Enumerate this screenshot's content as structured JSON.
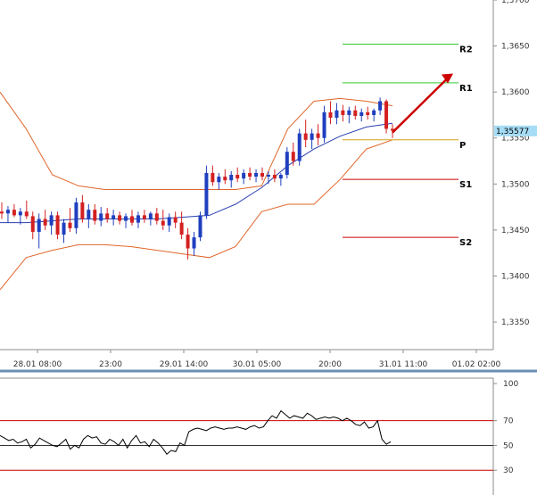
{
  "chart_data": [
    {
      "type": "candlestick",
      "x": [
        "28.01 08:00",
        "23:00",
        "29.01 14:00",
        "30.01 05:00",
        "20:00",
        "31.01 11:00",
        "01.02 02:00"
      ],
      "ytick_labels": [
        "1,3700",
        "1,3650",
        "1,3600",
        "1,3550",
        "1,3500",
        "1,3450",
        "1,3400",
        "1,3350"
      ],
      "yticks": [
        1.37,
        1.365,
        1.36,
        1.355,
        1.35,
        1.345,
        1.34,
        1.335
      ],
      "ylim": [
        1.332,
        1.37
      ],
      "current_price": 1.35577,
      "current_price_label": "1,35577",
      "grid": false,
      "levels": [
        {
          "name": "R2",
          "value": 1.3652,
          "color": "#33cc33"
        },
        {
          "name": "R1",
          "value": 1.361,
          "color": "#33cc33"
        },
        {
          "name": "P",
          "value": 1.3548,
          "color": "#d4a017"
        },
        {
          "name": "S1",
          "value": 1.3505,
          "color": "#cc0000"
        },
        {
          "name": "S2",
          "value": 1.3442,
          "color": "#cc0000"
        }
      ],
      "candles": [
        [
          1.347,
          1.348,
          1.3462,
          1.3468
        ],
        [
          1.3468,
          1.3476,
          1.3458,
          1.3472
        ],
        [
          1.3472,
          1.3478,
          1.3464,
          1.3466
        ],
        [
          1.3466,
          1.3474,
          1.3456,
          1.347
        ],
        [
          1.347,
          1.3482,
          1.3462,
          1.3465
        ],
        [
          1.3465,
          1.347,
          1.344,
          1.3448
        ],
        [
          1.3448,
          1.3468,
          1.343,
          1.3462
        ],
        [
          1.3462,
          1.3472,
          1.345,
          1.3455
        ],
        [
          1.3455,
          1.347,
          1.3445,
          1.3466
        ],
        [
          1.3466,
          1.347,
          1.344,
          1.3445
        ],
        [
          1.3445,
          1.3462,
          1.3436,
          1.3458
        ],
        [
          1.3458,
          1.3474,
          1.3448,
          1.3452
        ],
        [
          1.3452,
          1.3485,
          1.3446,
          1.348
        ],
        [
          1.348,
          1.3488,
          1.3458,
          1.3462
        ],
        [
          1.3462,
          1.3478,
          1.3452,
          1.3472
        ],
        [
          1.3472,
          1.3478,
          1.3456,
          1.346
        ],
        [
          1.346,
          1.3475,
          1.3454,
          1.3468
        ],
        [
          1.3468,
          1.3474,
          1.3458,
          1.3462
        ],
        [
          1.3462,
          1.3472,
          1.3455,
          1.3466
        ],
        [
          1.3466,
          1.347,
          1.3456,
          1.346
        ],
        [
          1.346,
          1.3468,
          1.3452,
          1.3465
        ],
        [
          1.3465,
          1.3472,
          1.3455,
          1.3458
        ],
        [
          1.3458,
          1.347,
          1.3452,
          1.3466
        ],
        [
          1.3466,
          1.3472,
          1.3458,
          1.3462
        ],
        [
          1.3462,
          1.347,
          1.3455,
          1.3468
        ],
        [
          1.3468,
          1.3474,
          1.3456,
          1.346
        ],
        [
          1.346,
          1.3472,
          1.345,
          1.3455
        ],
        [
          1.3455,
          1.3468,
          1.3448,
          1.3464
        ],
        [
          1.3464,
          1.347,
          1.3452,
          1.3458
        ],
        [
          1.3458,
          1.347,
          1.344,
          1.3445
        ],
        [
          1.3445,
          1.3452,
          1.3418,
          1.343
        ],
        [
          1.343,
          1.3448,
          1.3422,
          1.3442
        ],
        [
          1.3442,
          1.347,
          1.3438,
          1.3466
        ],
        [
          1.3466,
          1.352,
          1.3462,
          1.3512
        ],
        [
          1.3512,
          1.352,
          1.3498,
          1.3502
        ],
        [
          1.3502,
          1.3512,
          1.3494,
          1.3508
        ],
        [
          1.3508,
          1.3516,
          1.35,
          1.3504
        ],
        [
          1.3504,
          1.3514,
          1.3496,
          1.351
        ],
        [
          1.351,
          1.3518,
          1.3502,
          1.3506
        ],
        [
          1.3506,
          1.3516,
          1.35,
          1.3512
        ],
        [
          1.3512,
          1.3518,
          1.3504,
          1.3508
        ],
        [
          1.3508,
          1.3516,
          1.3502,
          1.3512
        ],
        [
          1.3512,
          1.3518,
          1.3504,
          1.3508
        ],
        [
          1.3508,
          1.3514,
          1.35,
          1.351
        ],
        [
          1.351,
          1.3516,
          1.3502,
          1.3506
        ],
        [
          1.3506,
          1.3512,
          1.3498,
          1.351
        ],
        [
          1.351,
          1.354,
          1.3506,
          1.3535
        ],
        [
          1.3535,
          1.3545,
          1.352,
          1.3525
        ],
        [
          1.3525,
          1.356,
          1.352,
          1.3555
        ],
        [
          1.3555,
          1.357,
          1.354,
          1.3548
        ],
        [
          1.3548,
          1.356,
          1.3538,
          1.3555
        ],
        [
          1.3555,
          1.3565,
          1.3542,
          1.355
        ],
        [
          1.355,
          1.3585,
          1.3545,
          1.3578
        ],
        [
          1.3578,
          1.359,
          1.3565,
          1.3572
        ],
        [
          1.3572,
          1.3588,
          1.3565,
          1.358
        ],
        [
          1.358,
          1.3586,
          1.3568,
          1.3575
        ],
        [
          1.3575,
          1.3584,
          1.3566,
          1.358
        ],
        [
          1.358,
          1.3585,
          1.357,
          1.3574
        ],
        [
          1.3574,
          1.3582,
          1.3568,
          1.3578
        ],
        [
          1.3578,
          1.3584,
          1.357,
          1.3575
        ],
        [
          1.3575,
          1.3582,
          1.3568,
          1.358
        ],
        [
          1.358,
          1.3594,
          1.3575,
          1.359
        ],
        [
          1.359,
          1.3592,
          1.3555,
          1.356
        ],
        [
          1.356,
          1.3565,
          1.355,
          1.3558
        ]
      ],
      "bollinger_upper": [
        1.36,
        1.356,
        1.351,
        1.3498,
        1.3494,
        1.3494,
        1.3494,
        1.3494,
        1.3494,
        1.3494,
        1.3498,
        1.356,
        1.359,
        1.3593,
        1.359,
        1.3585
      ],
      "bollinger_middle": [
        1.3458,
        1.3458,
        1.346,
        1.3462,
        1.3462,
        1.3462,
        1.3462,
        1.3464,
        1.3466,
        1.3478,
        1.3496,
        1.352,
        1.3538,
        1.3552,
        1.3562,
        1.3566
      ],
      "bollinger_lower": [
        1.3385,
        1.342,
        1.3428,
        1.3434,
        1.3434,
        1.3432,
        1.3428,
        1.3424,
        1.342,
        1.3432,
        1.347,
        1.3478,
        1.3478,
        1.3505,
        1.3538,
        1.3548
      ],
      "signal": {
        "from": 1.3556,
        "to": 1.362,
        "color": "#cc0000"
      }
    },
    {
      "type": "line",
      "x": [
        "28.01 08:00",
        "23:00",
        "29.01 14:00",
        "30.01 05:00",
        "20:00",
        "31.01 11:00",
        "01.02 02:00"
      ],
      "ytick_labels": [
        "100",
        "70",
        "50",
        "30"
      ],
      "yticks": [
        100,
        70,
        50,
        30
      ],
      "ylim": [
        10,
        100
      ],
      "levels": [
        {
          "value": 70,
          "color": "#cc0000"
        },
        {
          "value": 50,
          "color": "#333333"
        },
        {
          "value": 30,
          "color": "#cc0000"
        }
      ],
      "values": [
        58,
        56,
        54,
        55,
        52,
        53,
        55,
        48,
        51,
        56,
        54,
        52,
        50,
        49,
        52,
        55,
        47,
        50,
        48,
        55,
        58,
        56,
        57,
        52,
        51,
        55,
        53,
        50,
        55,
        48,
        54,
        58,
        52,
        53,
        49,
        55,
        52,
        48,
        43,
        46,
        45,
        52,
        50,
        61,
        63,
        64,
        63,
        62,
        64,
        65,
        64,
        63,
        64,
        64,
        65,
        64,
        63,
        65,
        66,
        64,
        65,
        70,
        74,
        72,
        78,
        75,
        72,
        74,
        73,
        72,
        76,
        74,
        71,
        72,
        73,
        72,
        73,
        72,
        70,
        72,
        70,
        67,
        66,
        69,
        64,
        65,
        70,
        55,
        51,
        53
      ]
    }
  ]
}
